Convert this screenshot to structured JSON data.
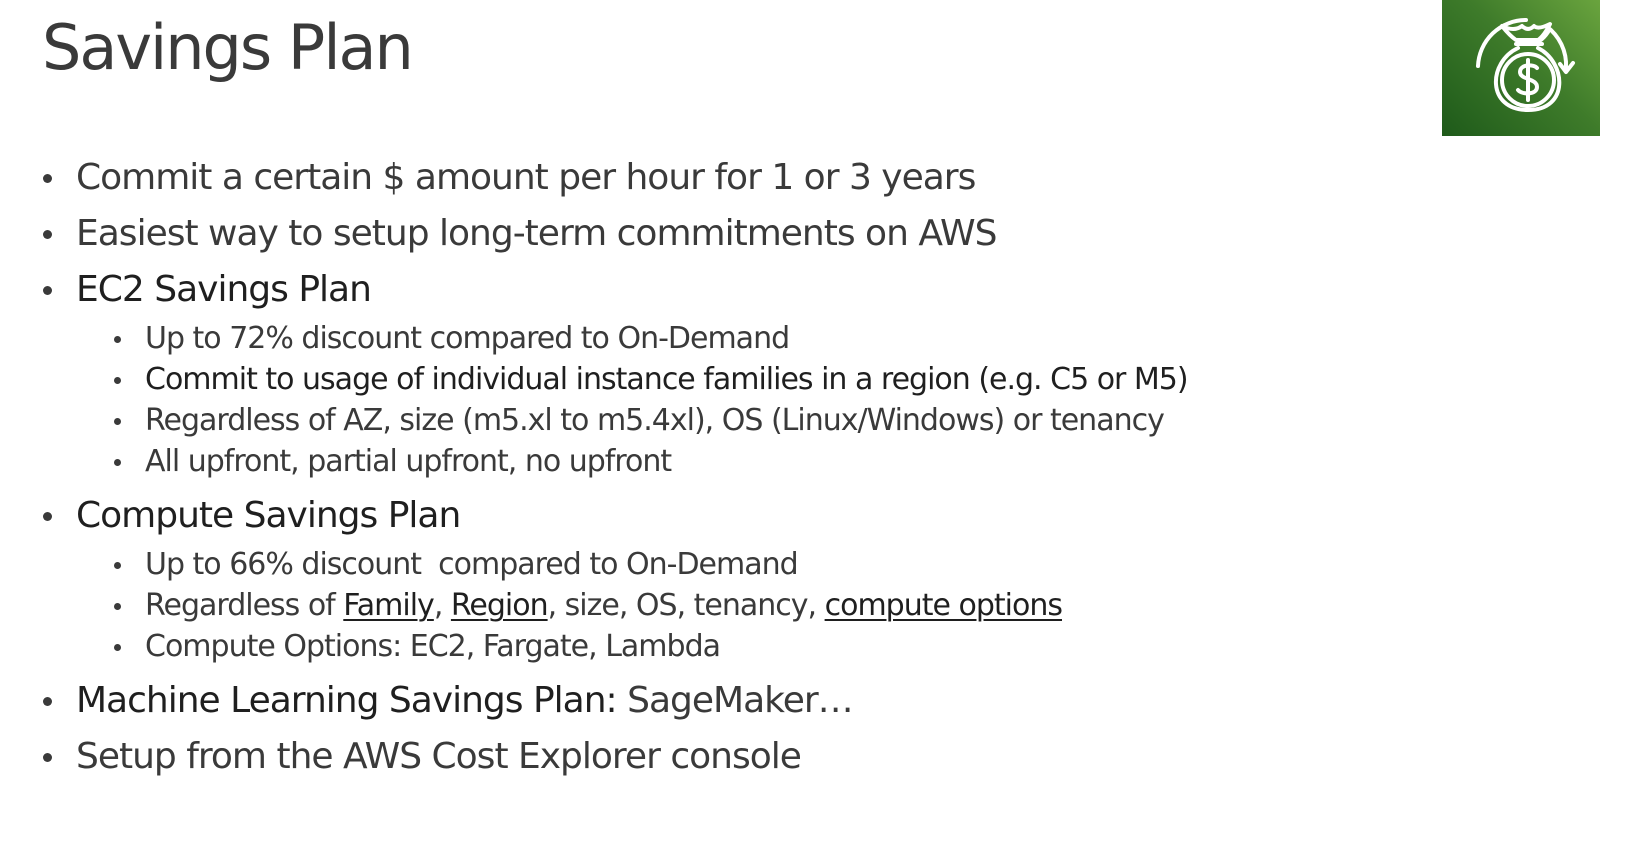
{
  "slide": {
    "title": "Savings Plan"
  },
  "logo": {
    "icon": "savings-plan-money-bag-icon",
    "colors": [
      "#1e5a1a",
      "#6aa43e"
    ]
  },
  "bullets": {
    "commit": "Commit a certain $ amount per hour for 1 or 3 years",
    "easiest": "Easiest way to setup long-term commitments on AWS",
    "ec2_plan": {
      "title": "EC2 Savings Plan",
      "items": [
        "Up to 72% discount compared to On-Demand",
        "Commit to usage of individual instance families in a region (e.g. C5 or M5)",
        "Regardless of AZ, size (m5.xl to m5.4xl), OS (Linux/Windows) or tenancy",
        "All upfront, partial upfront, no upfront"
      ]
    },
    "compute_plan": {
      "title": "Compute Savings Plan",
      "discount": "Up to 66% discount  compared to On-Demand",
      "regardless_parts": {
        "prefix": "Regardless of ",
        "family": "Family",
        "comma1": ", ",
        "region": "Region",
        "middle": ", size, OS, tenancy, ",
        "compute_options": "compute options"
      },
      "options": "Compute Options: EC2, Fargate, Lambda"
    },
    "ml_plan": {
      "label": "Machine Learning Savings Plan:",
      "value": " SageMaker…"
    },
    "setup": "Setup from the AWS Cost Explorer console"
  }
}
